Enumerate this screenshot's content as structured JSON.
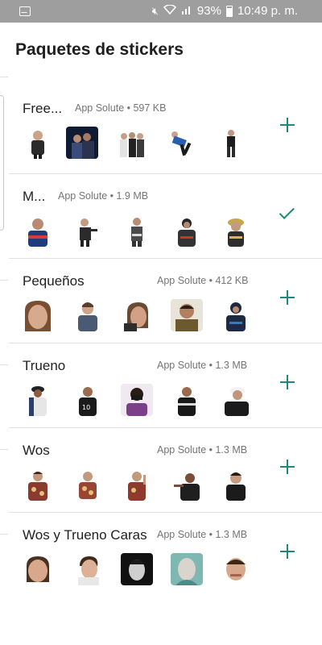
{
  "status_bar": {
    "icons": [
      "app-notification-icon",
      "mute-icon",
      "wifi-icon",
      "signal-icon",
      "battery-icon"
    ],
    "battery": "93%",
    "time": "10:49 p. m."
  },
  "header": {
    "title": "Paquetes de stickers"
  },
  "colors": {
    "accent": "#1b8a7a",
    "status_bar": "#9e9e9e",
    "divider": "#e0e0e0",
    "meta_text": "#757575"
  },
  "packs": [
    {
      "title": "Free...",
      "meta": "App Solute • 597 KB",
      "action": "add",
      "action_icon": "plus-icon"
    },
    {
      "title": "M...",
      "meta": "App Solute • 1.9 MB",
      "action": "added",
      "action_icon": "check-icon"
    },
    {
      "title": "Pequeños",
      "meta": "App Solute • 412 KB",
      "action": "add",
      "action_icon": "plus-icon"
    },
    {
      "title": "Trueno",
      "meta": "App Solute • 1.3 MB",
      "action": "add",
      "action_icon": "plus-icon"
    },
    {
      "title": "Wos",
      "meta": "App Solute • 1.3 MB",
      "action": "add",
      "action_icon": "plus-icon"
    },
    {
      "title": "Wos y Trueno Caras",
      "meta": "App Solute • 1.3 MB",
      "action": "add",
      "action_icon": "plus-icon"
    }
  ]
}
